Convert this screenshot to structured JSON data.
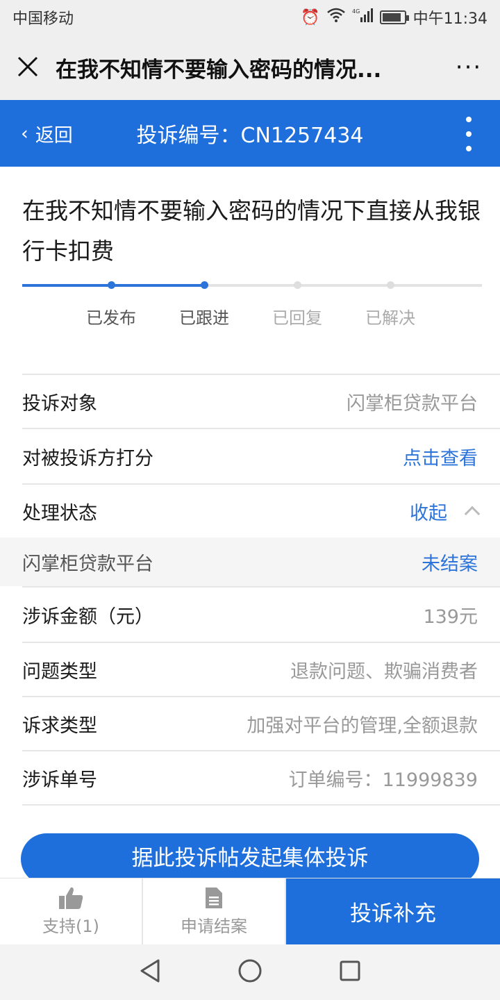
{
  "status_bar": {
    "carrier": "中国移动",
    "signal": "4G",
    "time": "中午11:34"
  },
  "webview": {
    "title": "在我不知情不要输入密码的情况..."
  },
  "nav": {
    "back_label": "返回",
    "title": "投诉编号：CN1257434"
  },
  "complaint": {
    "heading": "在我不知情不要输入密码的情况下直接从我银行卡扣费",
    "steps": [
      {
        "label": "已发布",
        "done": true
      },
      {
        "label": "已跟进",
        "done": true
      },
      {
        "label": "已回复",
        "done": false
      },
      {
        "label": "已解决",
        "done": false
      }
    ]
  },
  "details": {
    "target_label": "投诉对象",
    "target_value": "闪掌柜贷款平台",
    "rating_label": "对被投诉方打分",
    "rating_value": "点击查看",
    "status_label": "处理状态",
    "status_toggle": "收起",
    "merchant_name": "闪掌柜贷款平台",
    "merchant_status": "未结案",
    "amount_label": "涉诉金额（元）",
    "amount_value": "139元",
    "issue_label": "问题类型",
    "issue_value": "退款问题、欺骗消费者",
    "demand_label": "诉求类型",
    "demand_value": "加强对平台的管理,全额退款",
    "order_label": "涉诉单号",
    "order_value": "订单编号：11999839"
  },
  "actions": {
    "collective_label": "据此投诉帖发起集体投诉",
    "support_label": "支持(1)",
    "close_case_label": "申请结案",
    "supplement_label": "投诉补充"
  },
  "colors": {
    "brand_blue": "#1e6fdc",
    "link_blue": "#2d74da"
  }
}
